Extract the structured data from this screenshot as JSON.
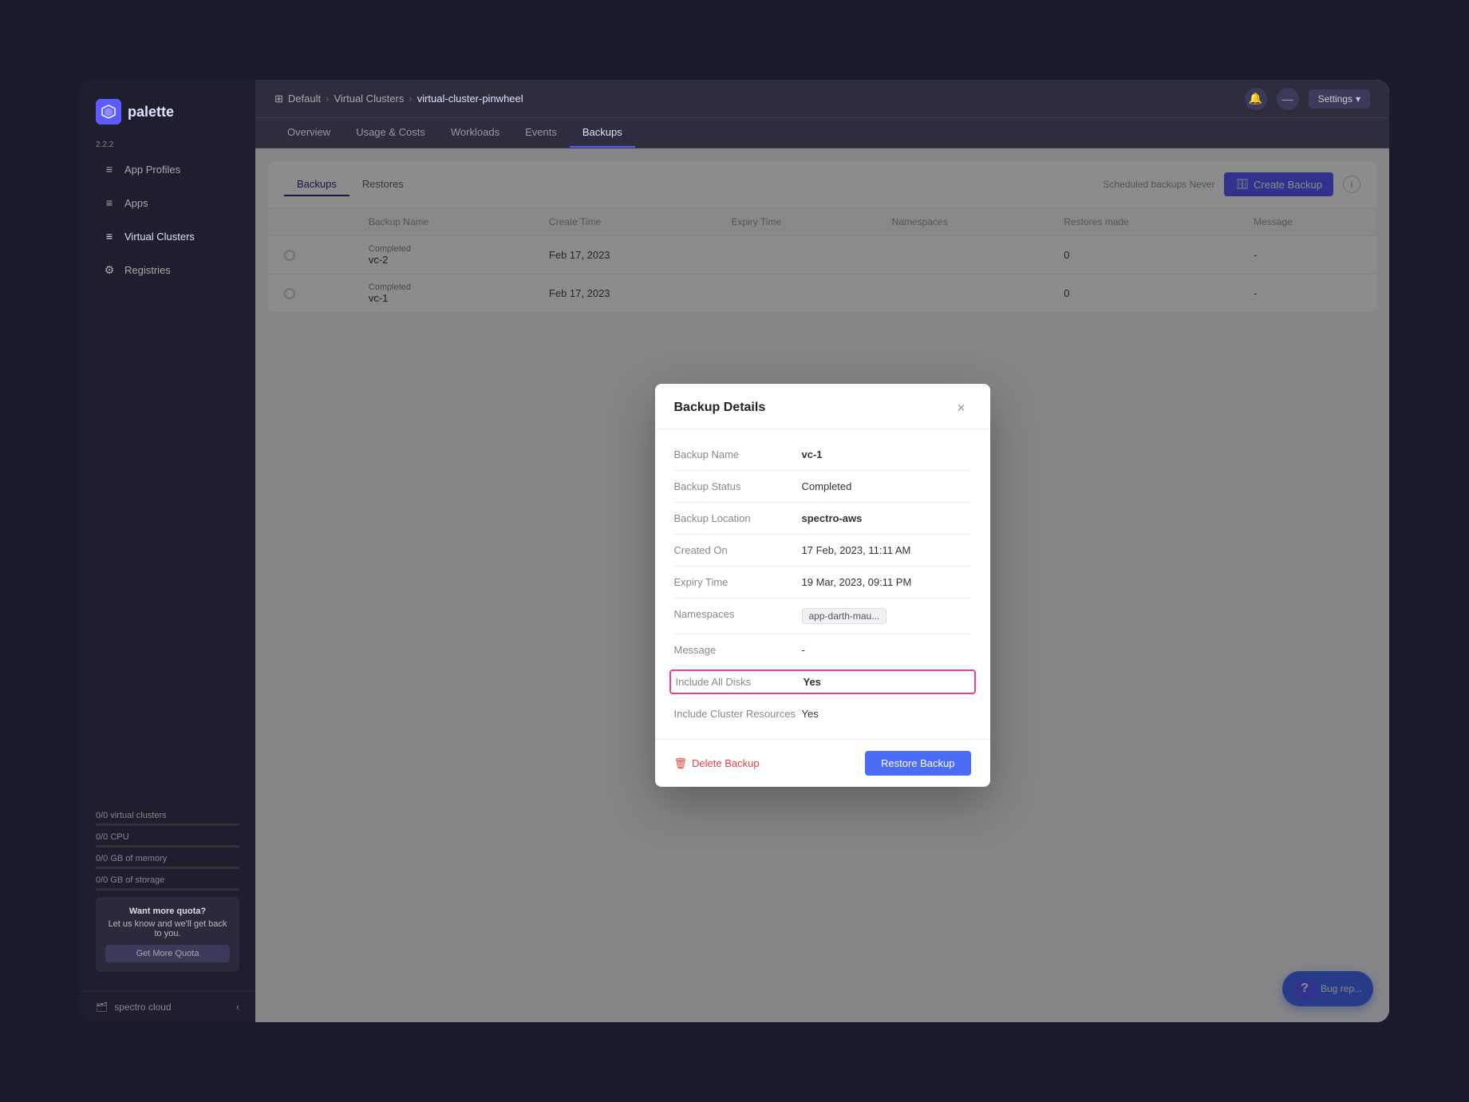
{
  "app": {
    "name": "palette",
    "version": "2.2.2"
  },
  "sidebar": {
    "nav_items": [
      {
        "label": "App Profiles",
        "icon": "≡",
        "active": false
      },
      {
        "label": "Apps",
        "icon": "≡",
        "active": false
      },
      {
        "label": "Virtual Clusters",
        "icon": "≡",
        "active": true
      },
      {
        "label": "Registries",
        "icon": "⚙",
        "active": false
      }
    ],
    "quota": {
      "virtual_clusters": "0/0 virtual clusters",
      "cpu": "0/0 CPU",
      "memory": "0/0 GB of memory",
      "storage": "0/0 GB of storage",
      "cta_title": "Want more quota?",
      "cta_text": "Let us know and we'll get back to you.",
      "cta_button": "Get More Quota"
    },
    "bottom": {
      "label": "spectro cloud",
      "collapse_icon": "‹"
    }
  },
  "topbar": {
    "breadcrumb": {
      "project": "Default",
      "section": "Virtual Clusters",
      "page": "virtual-cluster-pinwheel"
    },
    "settings_label": "Settings"
  },
  "tabs": [
    {
      "label": "Overview",
      "active": false
    },
    {
      "label": "Usage & Costs",
      "active": false
    },
    {
      "label": "Workloads",
      "active": false
    },
    {
      "label": "Events",
      "active": false
    },
    {
      "label": "Backups",
      "active": true
    }
  ],
  "backup_section": {
    "tabs": [
      {
        "label": "Backups",
        "active": true
      },
      {
        "label": "Restores",
        "active": false
      }
    ],
    "scheduled_text": "Scheduled backups Never",
    "create_backup_label": "Create Backup",
    "table": {
      "columns": [
        "Backup Name",
        "Create Time",
        "Expiry Time",
        "Namespaces",
        "Restores made",
        "Message"
      ],
      "rows": [
        {
          "status": "Completed",
          "name": "vc-2",
          "create_time": "Feb 17, 2023",
          "expiry_time": "",
          "namespaces": "",
          "restores_made": "0",
          "message": "-"
        },
        {
          "status": "Completed",
          "name": "vc-1",
          "create_time": "Feb 17, 2023",
          "expiry_time": "",
          "namespaces": "",
          "restores_made": "0",
          "message": "-"
        }
      ]
    }
  },
  "modal": {
    "title": "Backup Details",
    "fields": {
      "backup_name_label": "Backup Name",
      "backup_name_value": "vc-1",
      "backup_status_label": "Backup Status",
      "backup_status_value": "Completed",
      "backup_location_label": "Backup Location",
      "backup_location_value": "spectro-aws",
      "created_on_label": "Created On",
      "created_on_value": "17 Feb, 2023, 11:11 AM",
      "expiry_time_label": "Expiry Time",
      "expiry_time_value": "19 Mar, 2023, 09:11 PM",
      "namespaces_label": "Namespaces",
      "namespaces_value": "app-darth-mau...",
      "message_label": "Message",
      "message_value": "-",
      "include_all_disks_label": "Include All Disks",
      "include_all_disks_value": "Yes",
      "include_cluster_resources_label": "Include Cluster Resources",
      "include_cluster_resources_value": "Yes"
    },
    "delete_button": "Delete Backup",
    "restore_button": "Restore Backup"
  },
  "bug_report": {
    "label": "Bug rep...",
    "icon": "?"
  }
}
